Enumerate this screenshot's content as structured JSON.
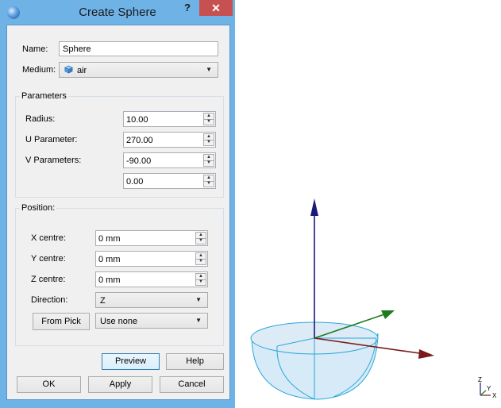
{
  "dialog": {
    "title": "Create Sphere",
    "help_icon": "?",
    "close_icon": "✕",
    "name_label": "Name:",
    "name_value": "Sphere",
    "medium_label": "Medium:",
    "medium_value": "air",
    "parameters": {
      "title": "Parameters",
      "radius_label": "Radius:",
      "radius_value": "10.00",
      "u_label": "U Parameter:",
      "u_value": "270.00",
      "v_label": "V Parameters:",
      "v_value1": "-90.00",
      "v_value2": "0.00"
    },
    "position": {
      "title": "Position:",
      "x_label": "X centre:",
      "x_value": "0 mm",
      "y_label": "Y centre:",
      "y_value": "0 mm",
      "z_label": "Z centre:",
      "z_value": "0 mm",
      "direction_label": "Direction:",
      "direction_value": "Z",
      "from_pick_label": "From Pick",
      "pick_value": "Use none"
    },
    "buttons": {
      "preview": "Preview",
      "help": "Help",
      "ok": "OK",
      "apply": "Apply",
      "cancel": "Cancel"
    }
  },
  "viewport": {
    "axis_labels": {
      "z": "Z",
      "y": "Y",
      "x": "X"
    },
    "colors": {
      "z_axis": "#1a1a7a",
      "y_axis": "#1f7a1f",
      "x_axis": "#7a1a1a",
      "sphere_fill": "#d6eaf8",
      "sphere_edge": "#2aa7d8"
    }
  }
}
